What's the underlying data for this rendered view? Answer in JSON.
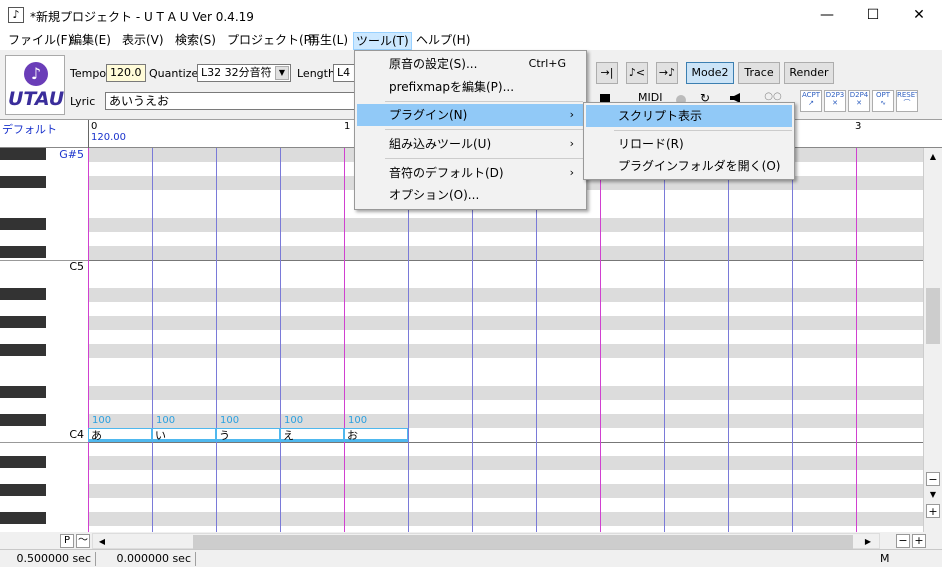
{
  "window": {
    "title": "*新規プロジェクト - U T A U Ver 0.4.19",
    "minimize": "—",
    "maximize": "☐",
    "close": "✕"
  },
  "menubar": [
    "ファイル(F)",
    "編集(E)",
    "表示(V)",
    "検索(S)",
    "プロジェクト(P)",
    "再生(L)",
    "ツール(T)",
    "ヘルプ(H)"
  ],
  "toolbar": {
    "logo_text": "UTAU",
    "tempo_label": "Tempo",
    "tempo_value": "120.0",
    "quantize_label": "Quantize",
    "quantize_value": "L32 32分音符",
    "length_label": "Length",
    "length_value": "L4",
    "lyric_label": "Lyric",
    "lyric_value": "あいうえお",
    "mode2": "Mode2",
    "trace": "Trace",
    "render": "Render",
    "midi": "MIDI",
    "plugin_buttons": [
      "ACPT",
      "D2P3",
      "D2P4",
      "OPT",
      "RESET"
    ]
  },
  "ruler": {
    "track": "デフォルト",
    "markers": [
      "0",
      "1",
      "3"
    ],
    "tempo": "120.00"
  },
  "piano": {
    "labels": [
      "G#5",
      "C5",
      "C4"
    ]
  },
  "notes": [
    {
      "lyric": "あ",
      "velocity": "100"
    },
    {
      "lyric": "い",
      "velocity": "100"
    },
    {
      "lyric": "う",
      "velocity": "100"
    },
    {
      "lyric": "え",
      "velocity": "100"
    },
    {
      "lyric": "お",
      "velocity": "100"
    }
  ],
  "tools_menu": {
    "items": [
      {
        "label": "原音の設定(S)...",
        "shortcut": "Ctrl+G"
      },
      {
        "label": "prefixmapを編集(P)..."
      },
      {
        "label": "プラグイン(N)",
        "submenu": true
      },
      {
        "label": "組み込みツール(U)",
        "submenu": true
      },
      {
        "label": "音符のデフォルト(D)",
        "submenu": true
      },
      {
        "label": "オプション(O)..."
      }
    ]
  },
  "plugin_submenu": [
    "スクリプト表示",
    "リロード(R)",
    "プラグインフォルダを開く(O)"
  ],
  "bottom": {
    "p": "P",
    "tilde": "～",
    "m": "M"
  },
  "status": [
    "0.500000 sec",
    "0.000000 sec"
  ],
  "colors": {
    "accent": "#cce8ff",
    "highlight": "#91c9f7",
    "note_border": "#4fb8ee",
    "bar_line": "#d040d0",
    "beat_line": "#7a7ad8"
  }
}
